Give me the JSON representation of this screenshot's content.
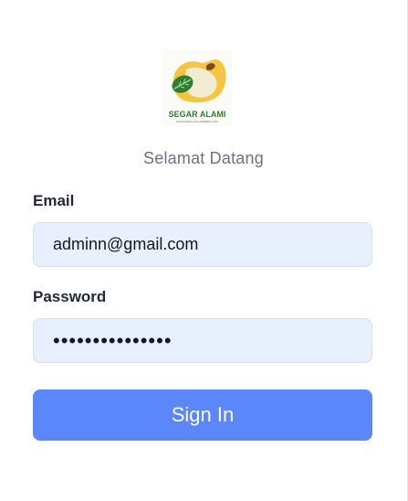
{
  "brand": {
    "logo_name": "SEGAR ALAMI",
    "logo_tagline": "PUSAT KEPALA DAN PEMBANG TANI"
  },
  "welcome_text": "Selamat Datang",
  "form": {
    "email_label": "Email",
    "email_value": "adminn@gmail.com",
    "password_label": "Password",
    "password_value": "•••••••••••••••",
    "submit_label": "Sign In"
  },
  "colors": {
    "primary_button": "#5b87fb",
    "input_background": "#e8effd",
    "logo_yellow": "#f5c542",
    "logo_green": "#2e7d32"
  },
  "icons": {
    "logo": "segar-alami-leaf-logo"
  }
}
